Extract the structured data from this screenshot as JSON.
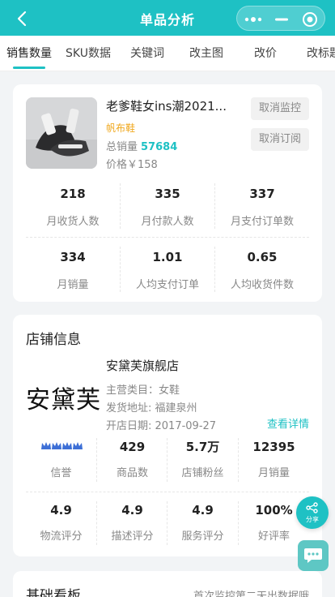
{
  "header": {
    "title": "单品分析",
    "capsule_icons": [
      "more-dots-icon",
      "minimize-icon",
      "target-icon"
    ]
  },
  "tabs": [
    {
      "label": "销售数量",
      "active": true
    },
    {
      "label": "SKU数据"
    },
    {
      "label": "关键词"
    },
    {
      "label": "改主图"
    },
    {
      "label": "改价"
    },
    {
      "label": "改标题"
    }
  ],
  "product": {
    "name": "老爹鞋女ins潮2021...",
    "tag": "帆布鞋",
    "total_label": "总销量",
    "total_value": "57684",
    "price": "价格￥158",
    "btn_cancel_monitor": "取消监控",
    "btn_cancel_subscribe": "取消订阅",
    "stats": [
      {
        "value": "218",
        "label": "月收货人数"
      },
      {
        "value": "335",
        "label": "月付款人数"
      },
      {
        "value": "337",
        "label": "月支付订单数"
      },
      {
        "value": "334",
        "label": "月销量"
      },
      {
        "value": "1.01",
        "label": "人均支付订单"
      },
      {
        "value": "0.65",
        "label": "人均收货件数"
      }
    ]
  },
  "shop": {
    "section_title": "店铺信息",
    "logo_text": "安黛芙",
    "name": "安黛芙旗舰店",
    "category": "主营类目：女鞋",
    "ship_from": "发货地址: 福建泉州",
    "open_date": "开店日期: 2017-09-27",
    "detail_link": "查看详情",
    "stats_row1": [
      {
        "value": "",
        "label": "信誉",
        "badge": "crown-badges-icon"
      },
      {
        "value": "429",
        "label": "商品数"
      },
      {
        "value": "5.7万",
        "label": "店铺粉丝"
      },
      {
        "value": "12395",
        "label": "月销量"
      }
    ],
    "stats_row2": [
      {
        "value": "4.9",
        "label": "物流评分"
      },
      {
        "value": "4.9",
        "label": "描述评分"
      },
      {
        "value": "4.9",
        "label": "服务评分"
      },
      {
        "value": "100%",
        "label": "好评率"
      }
    ]
  },
  "floating": {
    "share_label": "分享"
  },
  "board": {
    "title": "基础看板",
    "note": "首次监控第二天出数据哦"
  },
  "colors": {
    "accent": "#1ec1c4",
    "tag": "#f0a81e",
    "badge": "#3d6fd6"
  }
}
